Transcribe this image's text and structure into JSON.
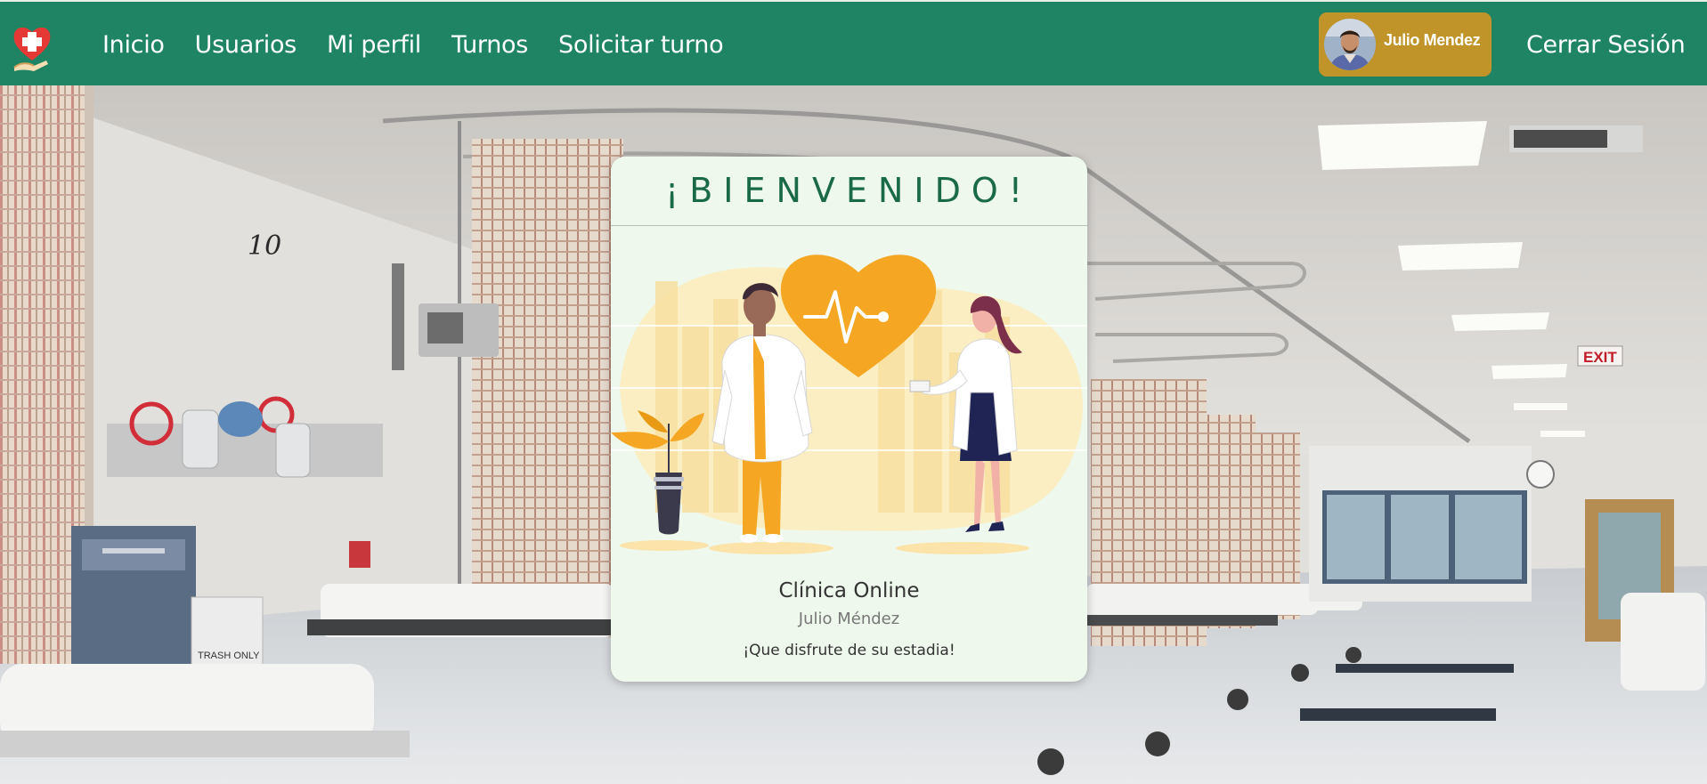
{
  "navbar": {
    "links": [
      "Inicio",
      "Usuarios",
      "Mi perfil",
      "Turnos",
      "Solicitar turno"
    ],
    "user_name": "Julio Mendez",
    "logout_label": "Cerrar Sesión"
  },
  "background": {
    "bed_number": "10",
    "exit_sign": "EXIT",
    "trash_label": "TRASH ONLY"
  },
  "welcome": {
    "title": "¡BIENVENIDO!",
    "clinic_name": "Clínica Online",
    "user_full_name": "Julio Méndez",
    "message": "¡Que disfrute de su estadia!"
  },
  "colors": {
    "navbar": "#1e8463",
    "user_chip": "#c09428",
    "card_background": "#eef8ec",
    "accent_orange": "#f5a623",
    "title_green": "#1a6a48"
  },
  "icons": [
    "clinic-heart-logo-icon",
    "user-avatar",
    "heartbeat-icon"
  ]
}
